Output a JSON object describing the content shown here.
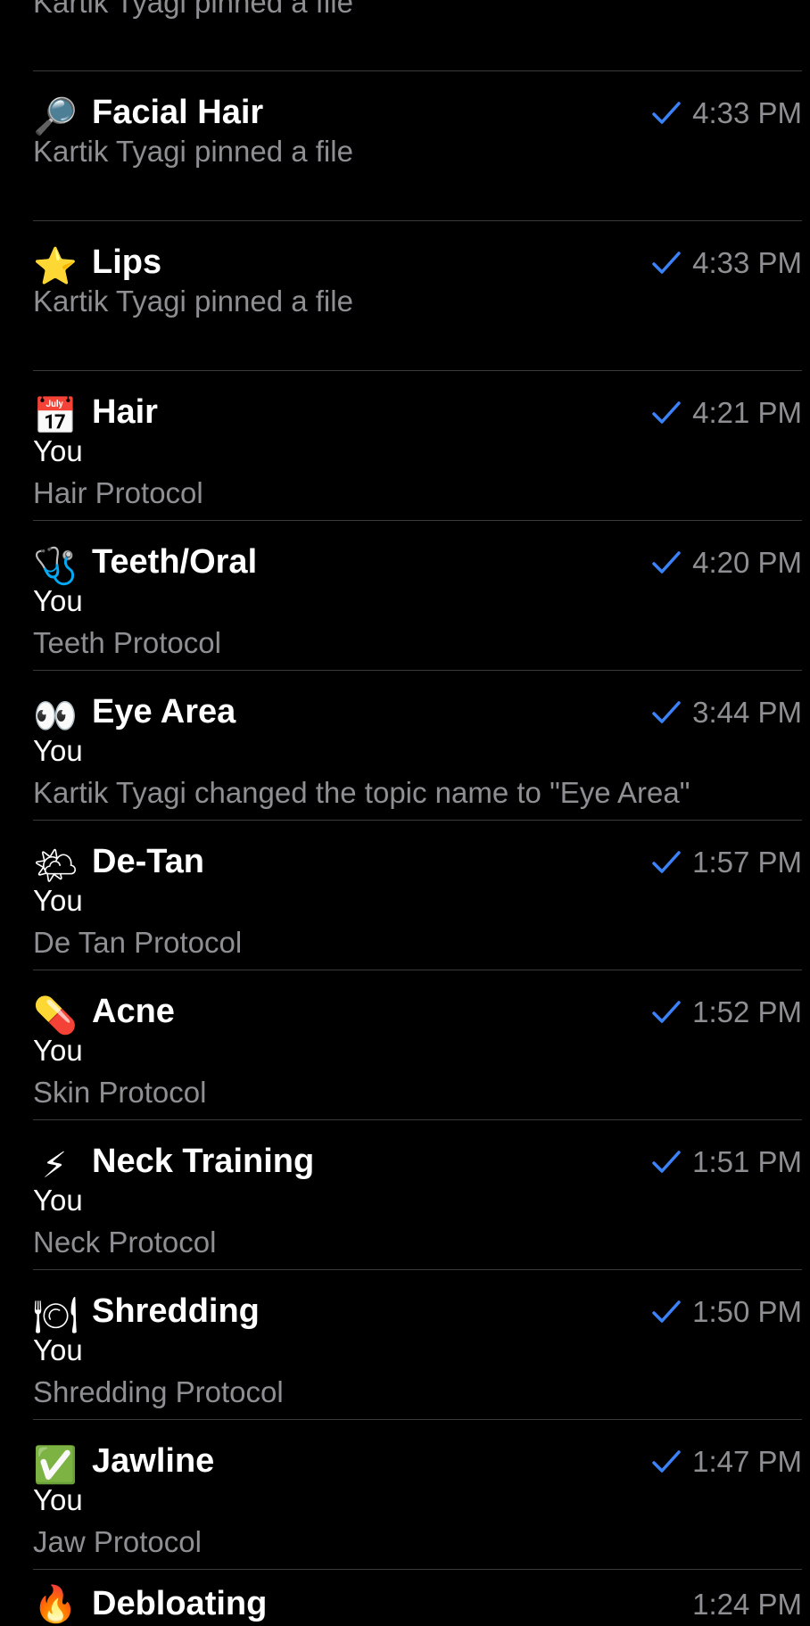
{
  "top_partial": {
    "preview": "Kartik Tyagi pinned a file"
  },
  "chats": [
    {
      "emoji": "🔎",
      "icon": "magnifying-glass-icon",
      "title": "Facial Hair",
      "time": "4:33 PM",
      "sender": "",
      "preview": "Kartik Tyagi pinned a file"
    },
    {
      "emoji": "⭐",
      "icon": "star-icon",
      "title": "Lips",
      "time": "4:33 PM",
      "sender": "",
      "preview": "Kartik Tyagi pinned a file"
    },
    {
      "emoji": "📅",
      "icon": "calendar-icon",
      "title": "Hair",
      "time": "4:21 PM",
      "sender": "You",
      "preview": "Hair Protocol"
    },
    {
      "emoji": "🩺",
      "icon": "stethoscope-icon",
      "title": "Teeth/Oral",
      "time": "4:20 PM",
      "sender": "You",
      "preview": "Teeth Protocol"
    },
    {
      "emoji": "👀",
      "icon": "eyes-icon",
      "title": "Eye Area",
      "time": "3:44 PM",
      "sender": "You",
      "preview": "Kartik Tyagi changed the topic name to \"Eye Area\""
    },
    {
      "emoji": "🌤",
      "icon": "sun-behind-cloud-icon",
      "title": "De-Tan",
      "time": "1:57 PM",
      "sender": "You",
      "preview": "De Tan Protocol"
    },
    {
      "emoji": "💊",
      "icon": "pill-icon",
      "title": "Acne",
      "time": "1:52 PM",
      "sender": "You",
      "preview": "Skin Protocol"
    },
    {
      "emoji": "⚡",
      "icon": "lightning-icon",
      "title": "Neck Training",
      "time": "1:51 PM",
      "sender": "You",
      "preview": "Neck Protocol"
    },
    {
      "emoji": "🍽",
      "icon": "plate-cutlery-icon",
      "title": "Shredding",
      "time": "1:50 PM",
      "sender": "You",
      "preview": "Shredding Protocol"
    },
    {
      "emoji": "✅",
      "icon": "check-box-icon",
      "title": "Jawline",
      "time": "1:47 PM",
      "sender": "You",
      "preview": "Jaw Protocol"
    }
  ],
  "bottom_partial": {
    "emoji": "🔥",
    "icon": "fire-icon",
    "title": "Debloating",
    "time": "1:24 PM"
  },
  "colors": {
    "background": "#000000",
    "title": "#ffffff",
    "secondary": "#8e8e93",
    "check": "#3a82f7",
    "divider": "#3a3a3c"
  }
}
